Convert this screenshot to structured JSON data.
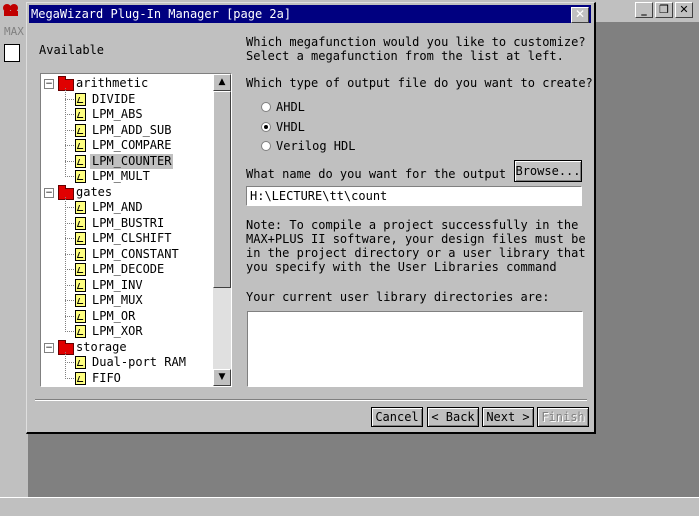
{
  "background_app": {
    "menu_label": "MAX",
    "window_buttons": {
      "minimize": "_",
      "restore": "❐",
      "close": "✕"
    }
  },
  "dialog": {
    "title": "MegaWizard Plug-In Manager [page 2a]",
    "close_glyph": "✕",
    "available_label": "Available",
    "tree": [
      {
        "type": "folder",
        "expanded": true,
        "label": "arithmetic",
        "children": [
          {
            "label": "DIVIDE"
          },
          {
            "label": "LPM_ABS"
          },
          {
            "label": "LPM_ADD_SUB"
          },
          {
            "label": "LPM_COMPARE"
          },
          {
            "label": "LPM_COUNTER",
            "selected": true
          },
          {
            "label": "LPM_MULT"
          }
        ]
      },
      {
        "type": "folder",
        "expanded": true,
        "label": "gates",
        "children": [
          {
            "label": "LPM_AND"
          },
          {
            "label": "LPM_BUSTRI"
          },
          {
            "label": "LPM_CLSHIFT"
          },
          {
            "label": "LPM_CONSTANT"
          },
          {
            "label": "LPM_DECODE"
          },
          {
            "label": "LPM_INV"
          },
          {
            "label": "LPM_MUX"
          },
          {
            "label": "LPM_OR"
          },
          {
            "label": "LPM_XOR"
          }
        ]
      },
      {
        "type": "folder",
        "expanded": true,
        "label": "storage",
        "children": [
          {
            "label": "Dual-port RAM"
          },
          {
            "label": "FIFO"
          }
        ]
      }
    ],
    "scroll": {
      "up": "▲",
      "down": "▼"
    },
    "question1_line1": "Which megafunction would you like to customize?",
    "question1_line2": "Select a megafunction from the list at left.",
    "question2": "Which type of output file do you want to create?",
    "output_types": [
      {
        "label": "AHDL",
        "checked": false
      },
      {
        "label": "VHDL",
        "checked": true
      },
      {
        "label": "Verilog HDL",
        "checked": false
      }
    ],
    "output_name_label": "What name do you want for the output",
    "browse_label": "Browse...",
    "output_value": "H:\\LECTURE\\tt\\count",
    "note_lines": [
      "Note: To compile a project successfully in the",
      "MAX+PLUS II software, your design files must be",
      "in the project directory or a user library that",
      "you specify with the User Libraries command"
    ],
    "library_label": "Your current user library directories are:",
    "buttons": {
      "cancel": "Cancel",
      "back": "< Back",
      "next": "Next >",
      "finish": "Finish"
    }
  }
}
